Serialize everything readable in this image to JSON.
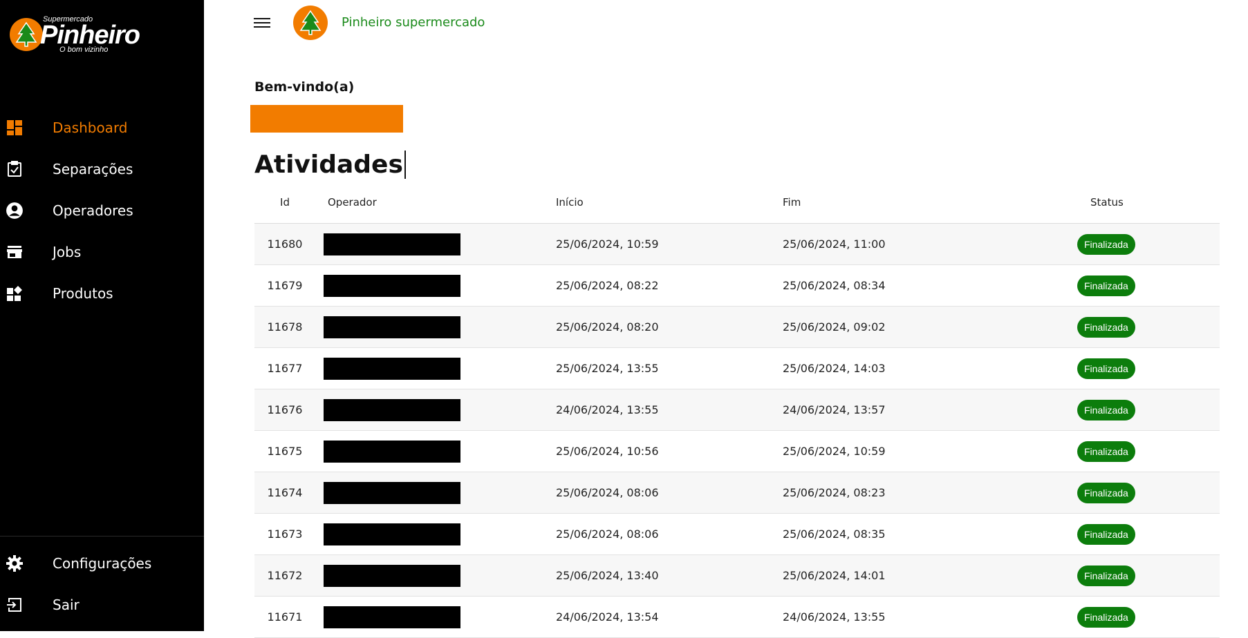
{
  "brand": {
    "logo_small": "Supermercado",
    "logo_main": "Pinheiro",
    "logo_sub": "O bom vizinho",
    "orange": "#f27c00",
    "green": "#1a8a1a"
  },
  "sidebar": {
    "items": [
      {
        "label": "Dashboard",
        "icon": "dashboard-icon",
        "active": true
      },
      {
        "label": "Separações",
        "icon": "clipboard-check-icon",
        "active": false
      },
      {
        "label": "Operadores",
        "icon": "account-circle-icon",
        "active": false
      },
      {
        "label": "Jobs",
        "icon": "storefront-icon",
        "active": false
      },
      {
        "label": "Produtos",
        "icon": "widgets-icon",
        "active": false
      }
    ],
    "bottom": [
      {
        "label": "Configurações",
        "icon": "gear-icon"
      },
      {
        "label": "Sair",
        "icon": "logout-icon"
      }
    ]
  },
  "header": {
    "title": "Pinheiro supermercado"
  },
  "main": {
    "welcome": "Bem-vindo(a)",
    "section_title": "Atividades",
    "columns": {
      "id": "Id",
      "operador": "Operador",
      "inicio": "Início",
      "fim": "Fim",
      "status": "Status"
    },
    "rows": [
      {
        "id": "11680",
        "inicio": "25/06/2024, 10:59",
        "fim": "25/06/2024, 11:00",
        "status": "Finalizada"
      },
      {
        "id": "11679",
        "inicio": "25/06/2024, 08:22",
        "fim": "25/06/2024, 08:34",
        "status": "Finalizada"
      },
      {
        "id": "11678",
        "inicio": "25/06/2024, 08:20",
        "fim": "25/06/2024, 09:02",
        "status": "Finalizada"
      },
      {
        "id": "11677",
        "inicio": "25/06/2024, 13:55",
        "fim": "25/06/2024, 14:03",
        "status": "Finalizada"
      },
      {
        "id": "11676",
        "inicio": "24/06/2024, 13:55",
        "fim": "24/06/2024, 13:57",
        "status": "Finalizada"
      },
      {
        "id": "11675",
        "inicio": "25/06/2024, 10:56",
        "fim": "25/06/2024, 10:59",
        "status": "Finalizada"
      },
      {
        "id": "11674",
        "inicio": "25/06/2024, 08:06",
        "fim": "25/06/2024, 08:23",
        "status": "Finalizada"
      },
      {
        "id": "11673",
        "inicio": "25/06/2024, 08:06",
        "fim": "25/06/2024, 08:35",
        "status": "Finalizada"
      },
      {
        "id": "11672",
        "inicio": "25/06/2024, 13:40",
        "fim": "25/06/2024, 14:01",
        "status": "Finalizada"
      },
      {
        "id": "11671",
        "inicio": "24/06/2024, 13:54",
        "fim": "24/06/2024, 13:55",
        "status": "Finalizada"
      }
    ]
  }
}
